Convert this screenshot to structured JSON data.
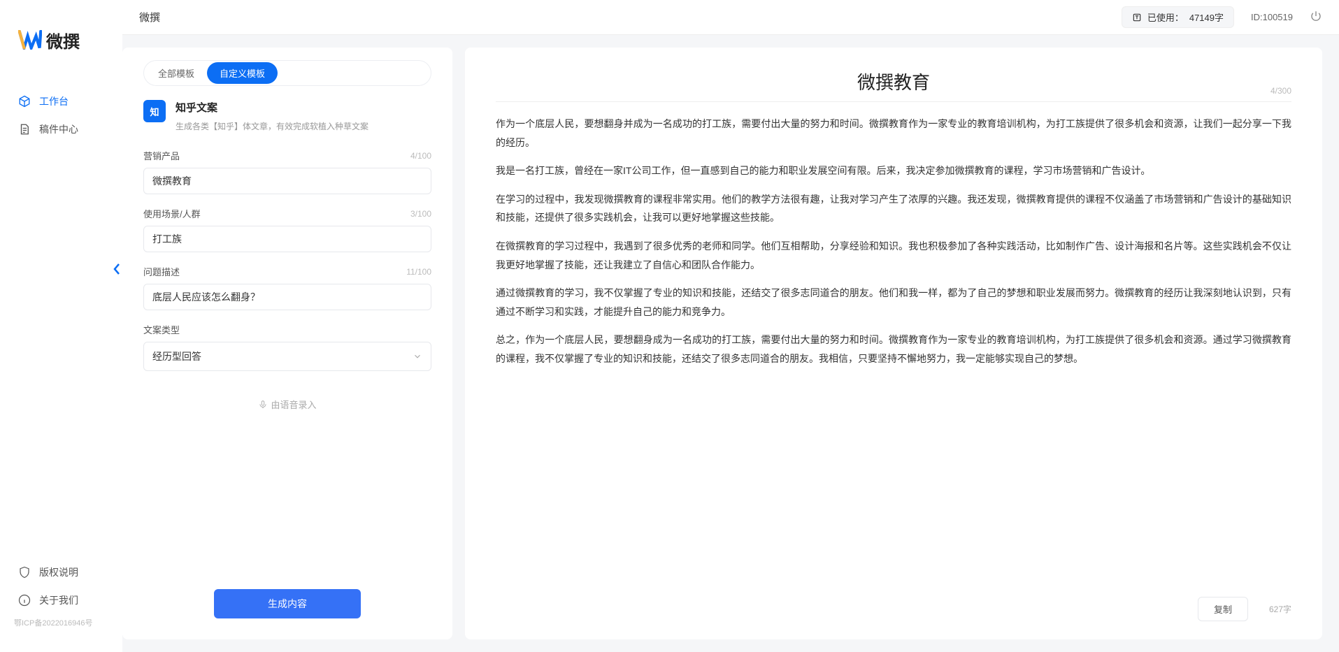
{
  "app": {
    "name": "微撰",
    "logo_text": "微撰"
  },
  "topbar": {
    "title": "微撰",
    "usage_label": "已使用：",
    "usage_value": "47149字",
    "id_label": "ID:100519"
  },
  "sidebar": {
    "items": [
      {
        "label": "工作台",
        "active": true
      },
      {
        "label": "稿件中心",
        "active": false
      }
    ],
    "footer": [
      {
        "label": "版权说明"
      },
      {
        "label": "关于我们"
      }
    ],
    "icp": "鄂ICP备2022016946号"
  },
  "tabs": [
    {
      "label": "全部模板",
      "active": false
    },
    {
      "label": "自定义模板",
      "active": true
    }
  ],
  "template": {
    "badge": "知",
    "title": "知乎文案",
    "desc": "生成各类【知乎】体文章，有效完成软植入种草文案"
  },
  "fields": {
    "product": {
      "label": "营销产品",
      "value": "微撰教育",
      "counter": "4/100"
    },
    "scene": {
      "label": "使用场景/人群",
      "value": "打工族",
      "counter": "3/100"
    },
    "problem": {
      "label": "问题描述",
      "value": "底层人民应该怎么翻身？",
      "counter": "11/100"
    },
    "type": {
      "label": "文案类型",
      "value": "经历型回答"
    }
  },
  "voice_hint": "由语音录入",
  "generate_label": "生成内容",
  "output": {
    "title": "微撰教育",
    "title_counter": "4/300",
    "paragraphs": [
      "作为一个底层人民，要想翻身并成为一名成功的打工族，需要付出大量的努力和时间。微撰教育作为一家专业的教育培训机构，为打工族提供了很多机会和资源，让我们一起分享一下我的经历。",
      "我是一名打工族，曾经在一家IT公司工作，但一直感到自己的能力和职业发展空间有限。后来，我决定参加微撰教育的课程，学习市场营销和广告设计。",
      "在学习的过程中，我发现微撰教育的课程非常实用。他们的教学方法很有趣，让我对学习产生了浓厚的兴趣。我还发现，微撰教育提供的课程不仅涵盖了市场营销和广告设计的基础知识和技能，还提供了很多实践机会，让我可以更好地掌握这些技能。",
      "在微撰教育的学习过程中，我遇到了很多优秀的老师和同学。他们互相帮助，分享经验和知识。我也积极参加了各种实践活动，比如制作广告、设计海报和名片等。这些实践机会不仅让我更好地掌握了技能，还让我建立了自信心和团队合作能力。",
      "通过微撰教育的学习，我不仅掌握了专业的知识和技能，还结交了很多志同道合的朋友。他们和我一样，都为了自己的梦想和职业发展而努力。微撰教育的经历让我深刻地认识到，只有通过不断学习和实践，才能提升自己的能力和竞争力。",
      "总之，作为一个底层人民，要想翻身成为一名成功的打工族，需要付出大量的努力和时间。微撰教育作为一家专业的教育培训机构，为打工族提供了很多机会和资源。通过学习微撰教育的课程，我不仅掌握了专业的知识和技能，还结交了很多志同道合的朋友。我相信，只要坚持不懈地努力，我一定能够实现自己的梦想。"
    ],
    "copy_label": "复制",
    "word_count": "627字"
  }
}
